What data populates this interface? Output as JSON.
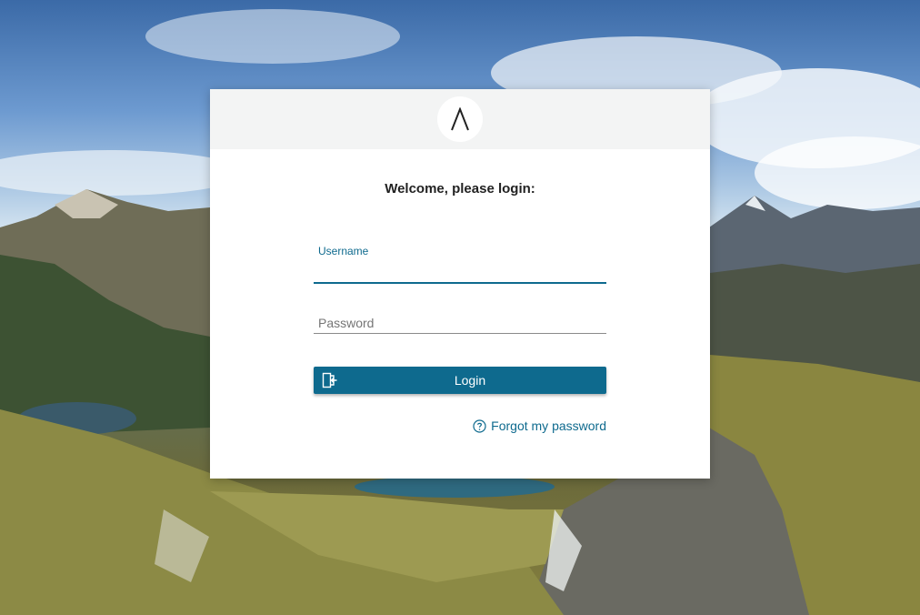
{
  "logo": {
    "icon": "lambda-logo-icon",
    "glyph": "Λ"
  },
  "form": {
    "heading": "Welcome, please login:",
    "username": {
      "label": "Username",
      "value": ""
    },
    "password": {
      "placeholder": "Password",
      "value": ""
    },
    "login_button": {
      "label": "Login",
      "icon": "login-door-icon"
    },
    "forgot_link": {
      "label": "Forgot my password",
      "icon": "question-circle-icon"
    }
  },
  "colors": {
    "accent": "#0e6a8e",
    "header_bg": "#f3f4f4",
    "card_bg": "#ffffff"
  }
}
